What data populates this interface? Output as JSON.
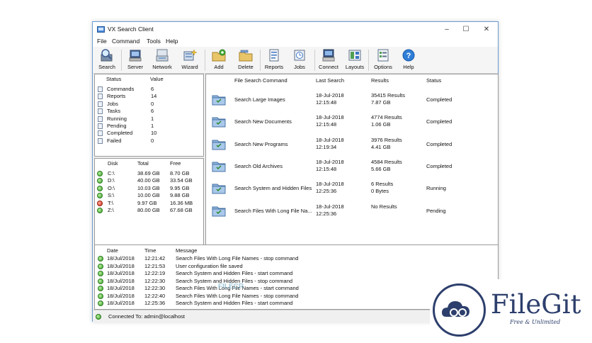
{
  "window": {
    "title": "VX Search Client",
    "minimize": "–",
    "maximize": "☐",
    "close": "✕"
  },
  "menu": [
    "File",
    "Command",
    "Tools",
    "Help"
  ],
  "toolbar": [
    {
      "label": "Search",
      "icon": "search-icon"
    },
    {
      "label": "Server",
      "icon": "server-icon"
    },
    {
      "label": "Network",
      "icon": "network-icon"
    },
    {
      "label": "Wizard",
      "icon": "wizard-icon"
    },
    {
      "label": "Add",
      "icon": "add-folder-icon"
    },
    {
      "label": "Delete",
      "icon": "delete-folder-icon"
    },
    {
      "label": "Reports",
      "icon": "reports-icon"
    },
    {
      "label": "Jobs",
      "icon": "jobs-icon"
    },
    {
      "label": "Connect",
      "icon": "connect-icon"
    },
    {
      "label": "Layouts",
      "icon": "layouts-icon"
    },
    {
      "label": "Options",
      "icon": "options-icon"
    },
    {
      "label": "Help",
      "icon": "help-icon"
    }
  ],
  "status_panel": {
    "headers": [
      "Status",
      "Value"
    ],
    "rows": [
      {
        "label": "Commands",
        "value": "6"
      },
      {
        "label": "Reports",
        "value": "14"
      },
      {
        "label": "Jobs",
        "value": "0"
      },
      {
        "label": "Tasks",
        "value": "6"
      },
      {
        "label": "Running",
        "value": "1"
      },
      {
        "label": "Pending",
        "value": "1"
      },
      {
        "label": "Completed",
        "value": "10"
      },
      {
        "label": "Failed",
        "value": "0"
      }
    ]
  },
  "disk_panel": {
    "headers": [
      "Disk",
      "Total",
      "Free"
    ],
    "rows": [
      {
        "disk": "C:\\",
        "total": "38.69 GB",
        "free": "8.70 GB",
        "state": "green"
      },
      {
        "disk": "D:\\",
        "total": "40.00 GB",
        "free": "33.54 GB",
        "state": "green"
      },
      {
        "disk": "O:\\",
        "total": "10.03 GB",
        "free": "9.95 GB",
        "state": "green"
      },
      {
        "disk": "S:\\",
        "total": "10.00 GB",
        "free": "9.88 GB",
        "state": "green"
      },
      {
        "disk": "T:\\",
        "total": "9.97 GB",
        "free": "16.36 MB",
        "state": "red"
      },
      {
        "disk": "Z:\\",
        "total": "80.00 GB",
        "free": "67.68 GB",
        "state": "green"
      }
    ]
  },
  "commands_panel": {
    "headers": [
      "File Search Command",
      "Last Search",
      "Results",
      "Status"
    ],
    "rows": [
      {
        "name": "Search Large Images",
        "date": "18-Jul-2018",
        "time": "12:15:48",
        "res1": "35415 Results",
        "res2": "7.87 GB",
        "status": "Completed"
      },
      {
        "name": "Search New Documents",
        "date": "18-Jul-2018",
        "time": "12:15:48",
        "res1": "4774 Results",
        "res2": "1.06 GB",
        "status": "Completed"
      },
      {
        "name": "Search New Programs",
        "date": "18-Jul-2018",
        "time": "12:19:34",
        "res1": "3976 Results",
        "res2": "4.41 GB",
        "status": "Completed"
      },
      {
        "name": "Search Old Archives",
        "date": "18-Jul-2018",
        "time": "12:15:48",
        "res1": "4584 Results",
        "res2": "5.66 GB",
        "status": "Completed"
      },
      {
        "name": "Search System and Hidden Files",
        "date": "18-Jul-2018",
        "time": "12:25:36",
        "res1": "6 Results",
        "res2": "0 Bytes",
        "status": "Running"
      },
      {
        "name": "Search Files With Long File Na...",
        "date": "18-Jul-2018",
        "time": "12:25:36",
        "res1": "No Results",
        "res2": "",
        "status": "Pending"
      }
    ]
  },
  "log_panel": {
    "headers": [
      "Date",
      "Time",
      "Message"
    ],
    "rows": [
      {
        "date": "18/Jul/2018",
        "time": "12:21:42",
        "message": "Search Files With Long File Names - stop command"
      },
      {
        "date": "18/Jul/2018",
        "time": "12:21:53",
        "message": "User configuration file saved"
      },
      {
        "date": "18/Jul/2018",
        "time": "12:22:19",
        "message": "Search System and Hidden Files - start command"
      },
      {
        "date": "18/Jul/2018",
        "time": "12:22:30",
        "message": "Search System and Hidden Files - stop command"
      },
      {
        "date": "18/Jul/2018",
        "time": "12:22:30",
        "message": "Search Files With Long File Names - start command"
      },
      {
        "date": "18/Jul/2018",
        "time": "12:22:40",
        "message": "Search Files With Long File Names - stop command"
      },
      {
        "date": "18/Jul/2018",
        "time": "12:25:36",
        "message": "Search System and Hidden Files - start command"
      }
    ]
  },
  "statusbar": {
    "text": "Connected To: admin@localhost"
  },
  "watermark": {
    "name": "FileGit",
    "tagline": "Free & Unlimited",
    "ghost": "FILECR"
  },
  "colors": {
    "window_border": "#6b9bd1",
    "accent_green": "#3da02a",
    "accent_red": "#d22a18",
    "brand": "#2d3f6c"
  }
}
